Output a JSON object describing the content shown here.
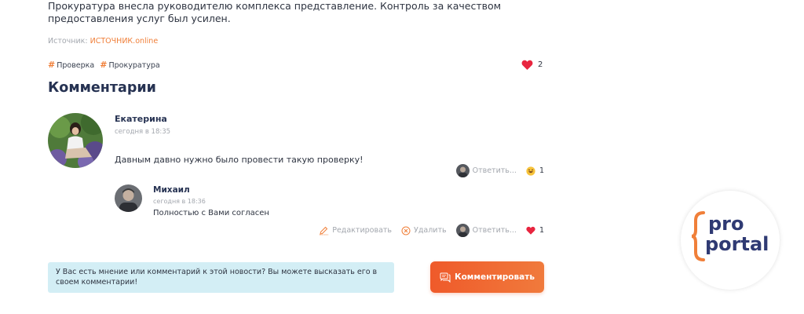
{
  "article": {
    "text": "Прокуратура внесла руководителю комплекса представление. Контроль за качеством предоставления услуг был усилен.",
    "source_label": "Источник: ",
    "source_link": "ИСТОЧНИК.online"
  },
  "tags": [
    "Проверка",
    "Прокуратура"
  ],
  "likes": {
    "count": "2"
  },
  "comments_title": "Комментарии",
  "comments": [
    {
      "author": "Екатерина",
      "time": "сегодня в 18:35",
      "text": "Давным давно нужно было провести такую проверку!",
      "actions": {
        "reply": "Ответить..."
      },
      "reaction": {
        "icon": "laugh-emoji-icon",
        "count": "1"
      }
    },
    {
      "author": "Михаил",
      "time": "сегодня в 18:36",
      "text": "Полностью с Вами согласен",
      "actions": {
        "edit": "Редактировать",
        "delete": "Удалить",
        "reply": "Ответить..."
      },
      "reaction": {
        "icon": "heart-icon",
        "count": "1"
      }
    }
  ],
  "notice": {
    "text": "У Вас есть мнение или комментарий к этой новости? Вы можете высказать его в своем комментарии!"
  },
  "comment_button": {
    "label": "Комментировать"
  },
  "logo": {
    "line1": "pro",
    "line2": "portal"
  },
  "colors": {
    "accent": "#f07f39",
    "button": "#ef5a2a",
    "heart": "#e8253f",
    "title": "#263252",
    "notice_bg": "#d3eef5",
    "logo": "#2f3a73"
  }
}
